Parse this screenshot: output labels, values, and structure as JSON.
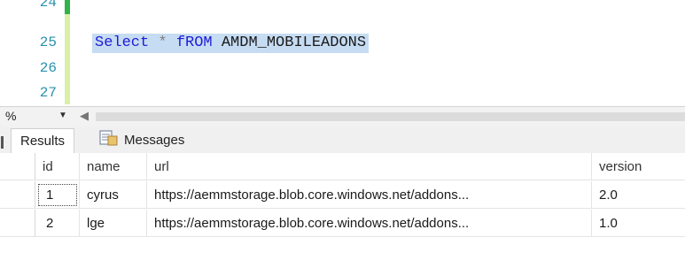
{
  "editor": {
    "line_numbers": [
      "24",
      "25",
      "26",
      "27"
    ],
    "query": {
      "keyword_select": "Select",
      "operator_star": "*",
      "keyword_from": "fROM",
      "table": "AMDM_MOBILEADONS"
    }
  },
  "zoombar": {
    "zoom_value": "%",
    "dropdown_glyph": "▼",
    "scroll_left_glyph": "◀"
  },
  "tabs": {
    "results_label": "Results",
    "messages_label": "Messages"
  },
  "grid": {
    "columns": [
      "id",
      "name",
      "url",
      "version"
    ],
    "rows": [
      {
        "row_number": "",
        "id": "1",
        "name": "cyrus",
        "url": "https://aemmstorage.blob.core.windows.net/addons...",
        "version": "2.0"
      },
      {
        "row_number": "",
        "id": "2",
        "name": "lge",
        "url": "https://aemmstorage.blob.core.windows.net/addons...",
        "version": "1.0"
      }
    ]
  },
  "icons": {
    "messages_tab": "messages-icon"
  },
  "colors": {
    "line_number": "#2b91af",
    "keyword": "#1c1cd6",
    "selection": "#c6dcf2",
    "change_bar_saved": "#2fb34a",
    "change_bar_unsaved": "#d8f0a8"
  }
}
